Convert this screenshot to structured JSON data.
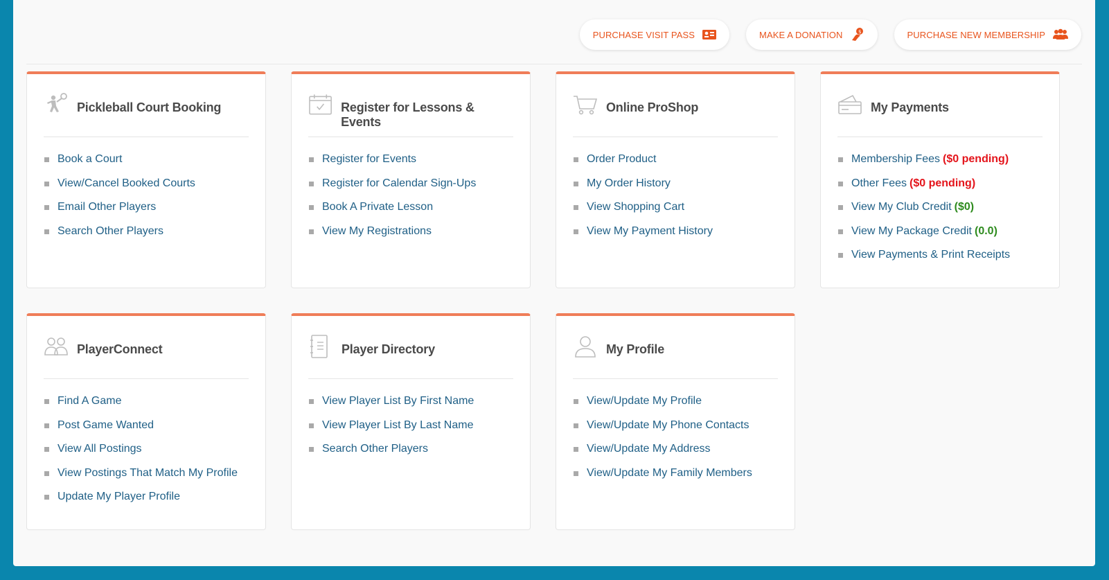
{
  "actions": [
    {
      "label": "PURCHASE VISIT PASS",
      "icon": "ticket-icon"
    },
    {
      "label": "MAKE A DONATION",
      "icon": "donation-icon"
    },
    {
      "label": "PURCHASE NEW MEMBERSHIP",
      "icon": "group-icon"
    }
  ],
  "colors": {
    "accent": "#e8541d",
    "card_border_top": "#ef7d58",
    "link": "#1f5f86",
    "pending": "#e4141b",
    "credit": "#2e8b1e",
    "frame": "#0a86ad"
  },
  "cards": {
    "court": {
      "title": "Pickleball Court Booking",
      "icon": "pickleball-player-icon",
      "items": [
        "Book a Court",
        "View/Cancel Booked Courts",
        "Email Other Players",
        "Search Other Players"
      ]
    },
    "lessons": {
      "title": "Register for Lessons & Events",
      "icon": "calendar-check-icon",
      "items": [
        "Register for Events",
        "Register for Calendar Sign-Ups",
        "Book A Private Lesson",
        "View My Registrations"
      ]
    },
    "proshop": {
      "title": "Online ProShop",
      "icon": "shopping-cart-icon",
      "items": [
        "Order Product",
        "My Order History",
        "View Shopping Cart",
        "View My Payment History"
      ]
    },
    "payments": {
      "title": "My Payments",
      "icon": "credit-card-icon",
      "items": [
        {
          "label": "Membership Fees",
          "extra": "($0 pending)"
        },
        {
          "label": "Other Fees",
          "extra": "($0 pending)"
        },
        {
          "label": "View My Club Credit",
          "extra": "($0)"
        },
        {
          "label": "View My Package Credit",
          "extra": "(0.0)"
        },
        {
          "label": "View Payments & Print Receipts"
        }
      ]
    },
    "connect": {
      "title": "PlayerConnect",
      "icon": "people-icon",
      "items": [
        "Find A Game",
        "Post Game Wanted",
        "View All Postings",
        "View Postings That Match My Profile",
        "Update My Player Profile"
      ]
    },
    "directory": {
      "title": "Player Directory",
      "icon": "notebook-icon",
      "items": [
        "View Player List By First Name",
        "View Player List By Last Name",
        "Search Other Players"
      ]
    },
    "profile": {
      "title": "My Profile",
      "icon": "user-icon",
      "items": [
        "View/Update My Profile",
        "View/Update My Phone Contacts",
        "View/Update My Address",
        "View/Update My Family Members"
      ]
    }
  }
}
